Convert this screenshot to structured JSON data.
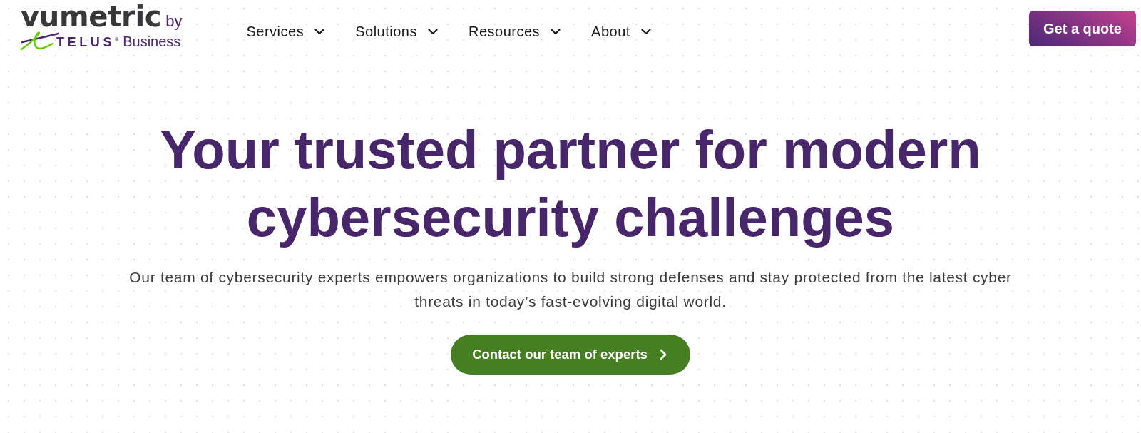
{
  "header": {
    "logo": {
      "wordmark": "vumetric",
      "by": "by",
      "brand": "TELUS$^{®}$",
      "brand_suffix": "Business"
    },
    "nav": [
      {
        "label": "Services",
        "has_dropdown": true
      },
      {
        "label": "Solutions",
        "has_dropdown": true
      },
      {
        "label": "Resources",
        "has_dropdown": true
      },
      {
        "label": "About",
        "has_dropdown": true
      }
    ],
    "cta": "Get a quote"
  },
  "hero": {
    "title": "Your trusted partner for modern cybersecurity challenges",
    "subtitle": "Our team of cybersecurity experts empowers organizations to build strong defenses and stay protected from the latest cyber threats in today’s fast-evolving digital world.",
    "button": {
      "label": "Contact our team of experts",
      "has_arrow": true
    }
  }
}
